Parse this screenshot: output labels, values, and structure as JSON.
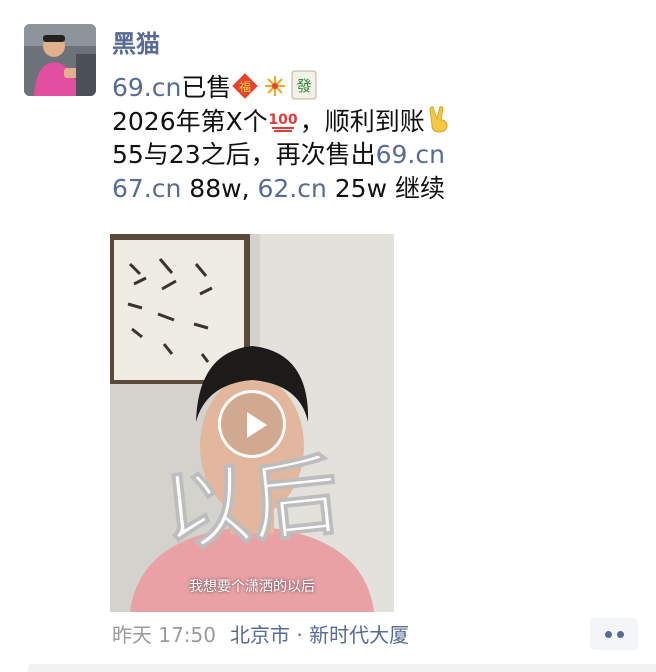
{
  "post": {
    "author": "黑猫",
    "lines": [
      {
        "link": "69.cn",
        "text": "已售"
      },
      {
        "text": "2026年第X个"
      },
      {
        "text": "，顺利到账"
      },
      {
        "text": "55与23之后，再次售出",
        "link": "69.cn"
      },
      {
        "link1": "67.cn",
        "text1": " 88w, ",
        "link2": "62.cn",
        "text2": " 25w 继续"
      }
    ],
    "emojis": [
      "fortune-diamond-icon",
      "fireworks-icon",
      "mahjong-fa-icon",
      "hundred-points-icon",
      "victory-hand-icon"
    ],
    "video": {
      "overlay_text": "以后",
      "subtitle": "我想要个潇洒的以后"
    },
    "time": "昨天 17:50",
    "location": "北京市 · 新时代大厦"
  },
  "colors": {
    "link": "#576b95",
    "text": "#111111",
    "meta": "#9b9b9b"
  }
}
